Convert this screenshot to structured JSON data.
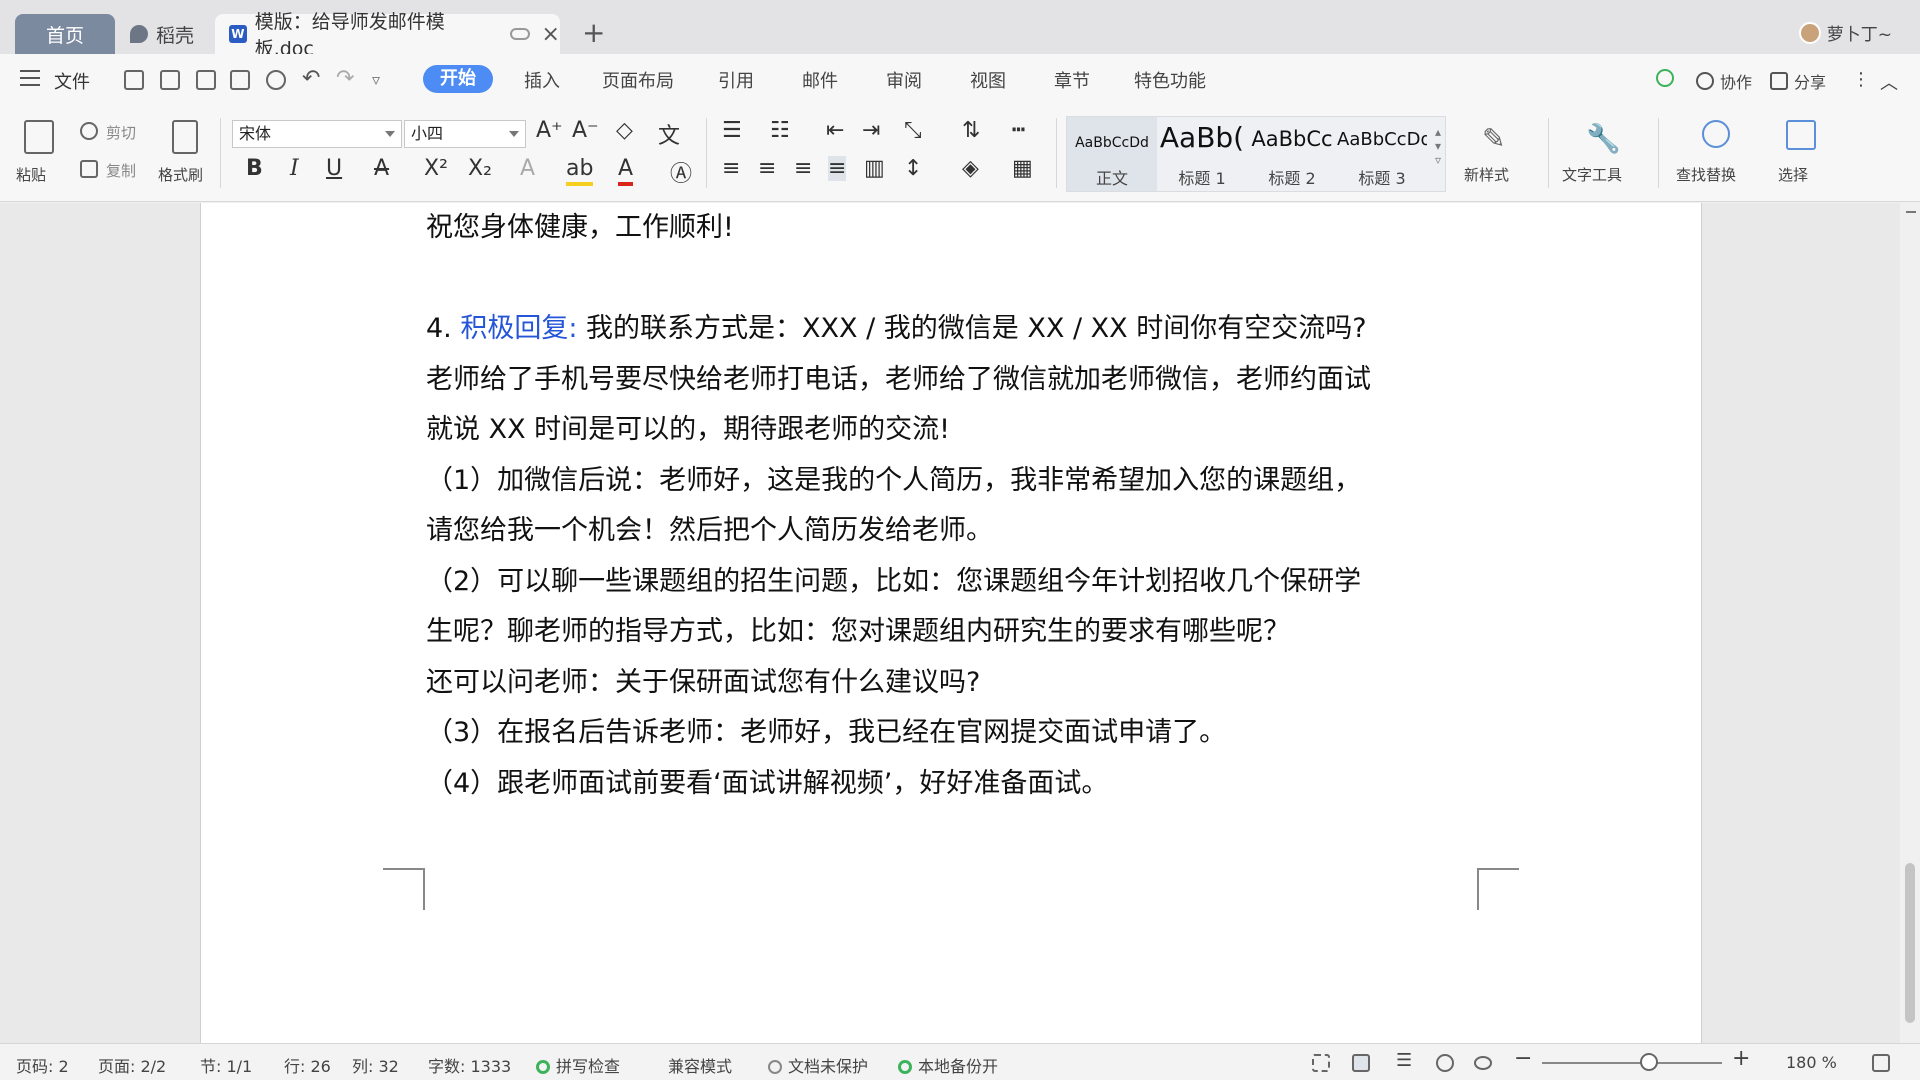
{
  "tabs": {
    "home": "首页",
    "daoke": "稻壳",
    "document": "模版：给导师发邮件模板.doc",
    "user": "萝卜丁~"
  },
  "menu": {
    "file": "文件",
    "tabs": [
      "开始",
      "插入",
      "页面布局",
      "引用",
      "邮件",
      "审阅",
      "视图",
      "章节",
      "特色功能"
    ],
    "collab": "协作",
    "share": "分享"
  },
  "ribbon": {
    "paste": "粘贴",
    "cut": "剪切",
    "copy": "复制",
    "format_painter": "格式刷",
    "font_name": "宋体",
    "font_size": "小四",
    "styles": [
      {
        "sample": "AaBbCcDd",
        "name": "正文"
      },
      {
        "sample": "AaBb(",
        "name": "标题 1"
      },
      {
        "sample": "AaBbCc",
        "name": "标题 2"
      },
      {
        "sample": "AaBbCcDd",
        "name": "标题 3"
      }
    ],
    "new_style": "新样式",
    "text_tools": "文字工具",
    "find_replace": "查找替换",
    "select": "选择"
  },
  "document": {
    "lines": [
      "祝您身体健康，工作顺利!",
      "",
      "",
      "老师给了手机号要尽快给老师打电话，老师给了微信就加老师微信，老师约面试",
      "就说 XX 时间是可以的，期待跟老师的交流!",
      "（1）加微信后说：老师好，这是我的个人简历，我非常希望加入您的课题组，",
      "请您给我一个机会！然后把个人简历发给老师。",
      "（2）可以聊一些课题组的招生问题，比如：您课题组今年计划招收几个保研学",
      "生呢？聊老师的指导方式，比如：您对课题组内研究生的要求有哪些呢？",
      "还可以问老师：关于保研面试您有什么建议吗?",
      "（3）在报名后告诉老师：老师好，我已经在官网提交面试申请了。",
      "（4）跟老师面试前要看‘面试讲解视频’，好好准备面试。"
    ],
    "item4_number": "4. ",
    "item4_highlight": "积极回复:",
    "item4_rest": " 我的联系方式是：XXX / 我的微信是 XX / XX 时间你有空交流吗?"
  },
  "status": {
    "page_code": "页码: 2",
    "page": "页面: 2/2",
    "section": "节: 1/1",
    "row": "行: 26",
    "col": "列: 32",
    "word_count": "字数: 1333",
    "spell_check": "拼写检查",
    "compat_mode": "兼容模式",
    "protection": "文档未保护",
    "backup": "本地备份开",
    "zoom": "180 %"
  }
}
